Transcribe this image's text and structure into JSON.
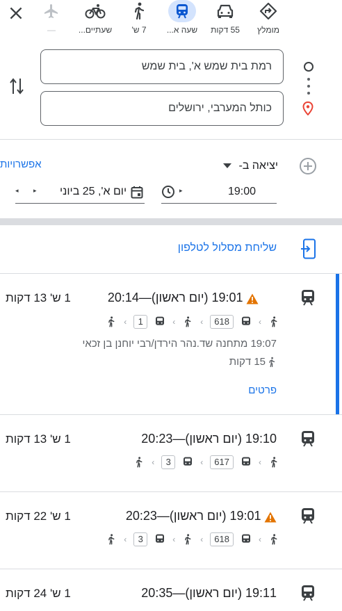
{
  "top_modes": [
    {
      "name": "best",
      "label": "מומלץ",
      "icon": "directions-icon"
    },
    {
      "name": "drive",
      "label": "55 דקות",
      "icon": "car-icon"
    },
    {
      "name": "transit",
      "label": "שעה א...",
      "icon": "train-icon",
      "selected": true
    },
    {
      "name": "walk",
      "label": "7 ש'",
      "icon": "walk-icon"
    },
    {
      "name": "bike",
      "label": "שעתיים...",
      "icon": "bike-icon"
    },
    {
      "name": "flight",
      "label": "—",
      "icon": "flight-icon"
    }
  ],
  "origin": "רמת בית שמש א', בית שמש",
  "destination": "כותל המערבי, ירושלים",
  "depart": {
    "label": "יציאה ב-",
    "options_link": "אפשרויות",
    "date": "יום א', 25 ביוני",
    "time": "19:00"
  },
  "send_to_phone": "שליחת מסלול לטלפון",
  "results": [
    {
      "times": "19:01 (יום ראשון)—20:14",
      "duration": "1 ש' 13 דקות",
      "warning": true,
      "route": [
        "618",
        "1"
      ],
      "detail": "19:07 מתחנה שד.נהר הירדן/רבי יוחנן בן זכאי",
      "walk": "15 דקות",
      "details_link": "פרטים"
    },
    {
      "times": "19:10 (יום ראשון)—20:23",
      "duration": "1 ש' 13 דקות",
      "warning": false,
      "route": [
        "617",
        "3"
      ]
    },
    {
      "times": "19:01 (יום ראשון)—20:23",
      "duration": "1 ש' 22 דקות",
      "warning": true,
      "route": [
        "618",
        "3"
      ]
    },
    {
      "times": "19:11 (יום ראשון)—20:35",
      "duration": "1 ש' 24 דקות",
      "warning": false
    }
  ],
  "colors": {
    "accent": "#1a73e8",
    "selected_bg": "#d3e3fd",
    "warning": "#e37400",
    "pin": "#ea4335"
  }
}
